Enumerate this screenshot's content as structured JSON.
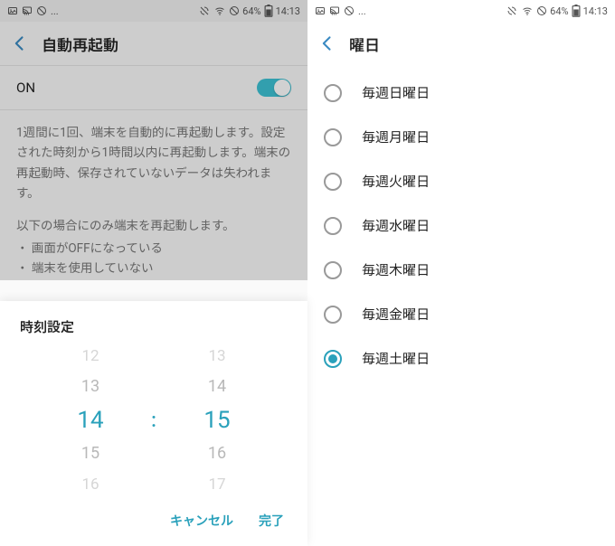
{
  "status": {
    "battery_text": "64%",
    "time": "14:13",
    "ellipsis": "..."
  },
  "left": {
    "title": "自動再起動",
    "toggle_label": "ON",
    "desc1": "1週間に1回、端末を自動的に再起動します。設定された時刻から1時間以内に再起動します。端末の再起動時、保存されていないデータは失われます。",
    "desc2": "以下の場合にのみ端末を再起動します。",
    "bullets": [
      "画面がOFFになっている",
      "端末を使用していない"
    ],
    "sheet": {
      "title": "時刻設定",
      "hours": [
        "12",
        "13",
        "14",
        "15",
        "16"
      ],
      "minutes": [
        "13",
        "14",
        "15",
        "16",
        "17"
      ],
      "selected_hour": "14",
      "selected_minute": "15",
      "cancel": "キャンセル",
      "done": "完了"
    }
  },
  "right": {
    "title": "曜日",
    "options": [
      {
        "label": "毎週日曜日",
        "selected": false
      },
      {
        "label": "毎週月曜日",
        "selected": false
      },
      {
        "label": "毎週火曜日",
        "selected": false
      },
      {
        "label": "毎週水曜日",
        "selected": false
      },
      {
        "label": "毎週木曜日",
        "selected": false
      },
      {
        "label": "毎週金曜日",
        "selected": false
      },
      {
        "label": "毎週土曜日",
        "selected": true
      }
    ]
  }
}
